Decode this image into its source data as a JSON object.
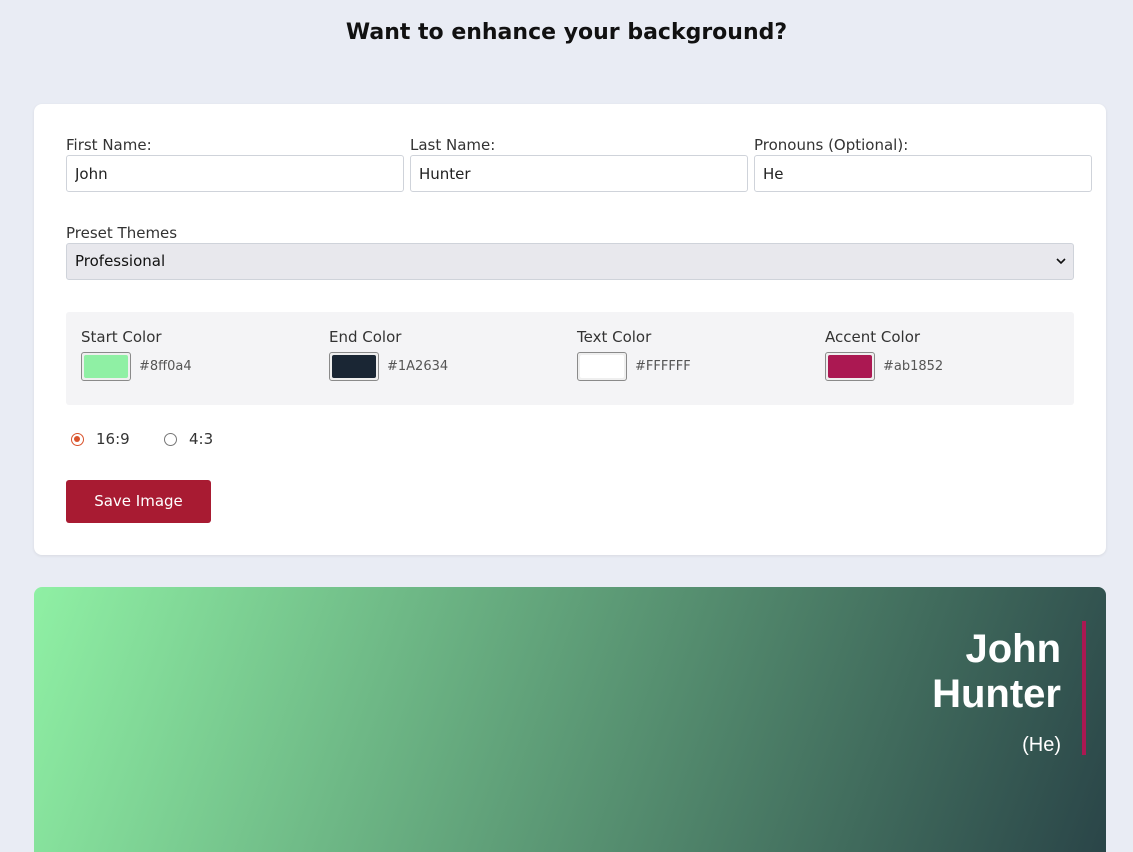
{
  "header": {
    "title": "Want to enhance your background?"
  },
  "form": {
    "first_name": {
      "label": "First Name:",
      "value": "John"
    },
    "last_name": {
      "label": "Last Name:",
      "value": "Hunter"
    },
    "pronouns": {
      "label": "Pronouns (Optional):",
      "value": "He"
    },
    "theme": {
      "label": "Preset Themes",
      "selected": "Professional"
    },
    "colors": {
      "start": {
        "label": "Start Color",
        "hex": "#8ff0a4"
      },
      "end": {
        "label": "End Color",
        "hex": "#1A2634"
      },
      "text": {
        "label": "Text Color",
        "hex": "#FFFFFF"
      },
      "accent": {
        "label": "Accent Color",
        "hex": "#ab1852"
      }
    },
    "aspect": {
      "options": [
        {
          "label": "16:9",
          "checked": true
        },
        {
          "label": "4:3",
          "checked": false
        }
      ]
    },
    "save_label": "Save Image"
  },
  "preview": {
    "first": "John",
    "last": "Hunter",
    "pronouns": "(He)",
    "gradient_start": "#8ff0a4",
    "gradient_end": "#2a4548",
    "text_color": "#FFFFFF",
    "accent_color": "#ab1852"
  }
}
